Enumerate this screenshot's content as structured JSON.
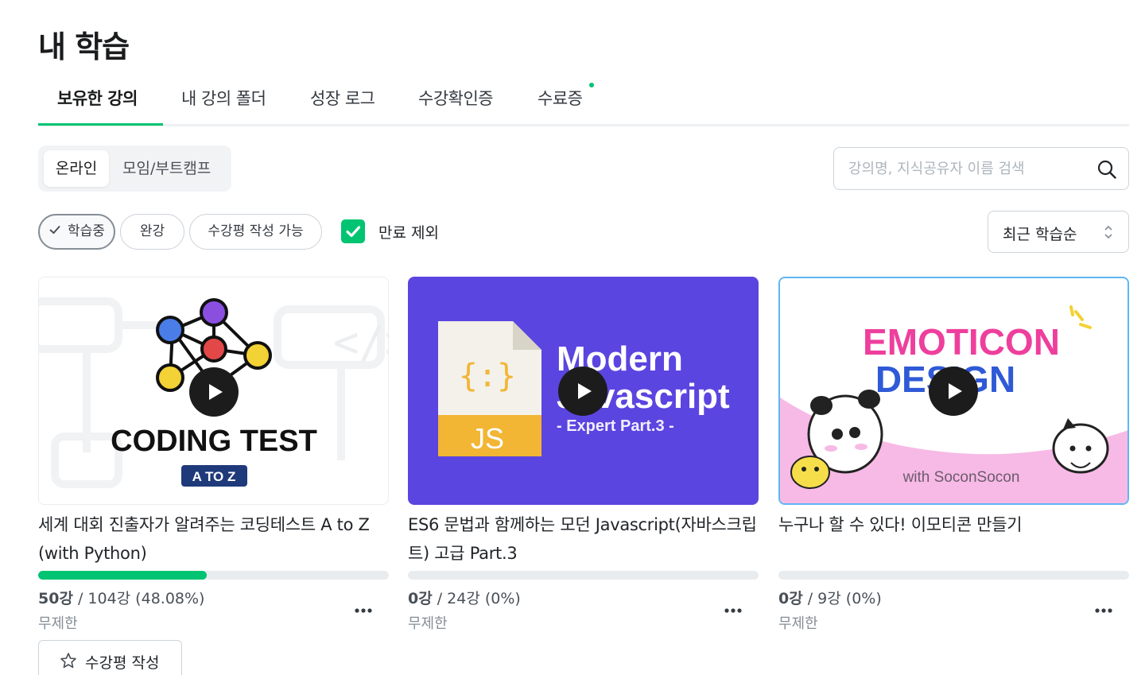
{
  "page": {
    "title": "내 학습"
  },
  "tabs": [
    {
      "label": "보유한 강의",
      "active": true
    },
    {
      "label": "내 강의 폴더",
      "active": false
    },
    {
      "label": "성장 로그",
      "active": false
    },
    {
      "label": "수강확인증",
      "active": false
    },
    {
      "label": "수료증",
      "active": false,
      "new_dot": true
    }
  ],
  "segment": {
    "items": [
      "온라인",
      "모임/부트캠프"
    ],
    "selected": "온라인"
  },
  "search": {
    "placeholder": "강의명, 지식공유자 이름 검색",
    "value": ""
  },
  "filters": {
    "chips": [
      {
        "label": "학습중",
        "selected": true
      },
      {
        "label": "완강",
        "selected": false
      },
      {
        "label": "수강평 작성 가능",
        "selected": false
      }
    ],
    "exclude_expired": {
      "label": "만료 제외",
      "checked": true
    }
  },
  "sort": {
    "selected": "최근 학습순"
  },
  "courses": [
    {
      "title": "세계 대회 진출자가 알려주는 코딩테스트 A to Z (with Python)",
      "thumb": {
        "text1": "CODING TEST",
        "text2": "A TO Z"
      },
      "progress_fraction": 0.4808,
      "done_label": "50강",
      "total_label": " / 104강 (48.08%)",
      "period": "무제한",
      "review_button": "수강평 작성"
    },
    {
      "title": "ES6 문법과 함께하는 모던 Javascript(자바스크립트) 고급 Part.3",
      "thumb": {
        "text1": "Modern",
        "text2": "Javascript",
        "text3": "- Expert Part.3 -",
        "file_label": "JS",
        "brace": "{:}"
      },
      "progress_fraction": 0,
      "done_label": "0강",
      "total_label": " / 24강 (0%)",
      "period": "무제한"
    },
    {
      "title": "누구나 할 수 있다! 이모티콘 만들기",
      "thumb": {
        "text1": "EMOTICON",
        "text2": "DESIGN",
        "text3": "with SoconSocon"
      },
      "progress_fraction": 0,
      "done_label": "0강",
      "total_label": " / 9강 (0%)",
      "period": "무제한"
    }
  ],
  "colors": {
    "accent": "#00c471",
    "js_purple": "#5b45e0",
    "emoticon_pink": "#f7b9e5",
    "emoticon_magenta": "#ee3f9d",
    "emoticon_blue": "#2f59d6"
  }
}
